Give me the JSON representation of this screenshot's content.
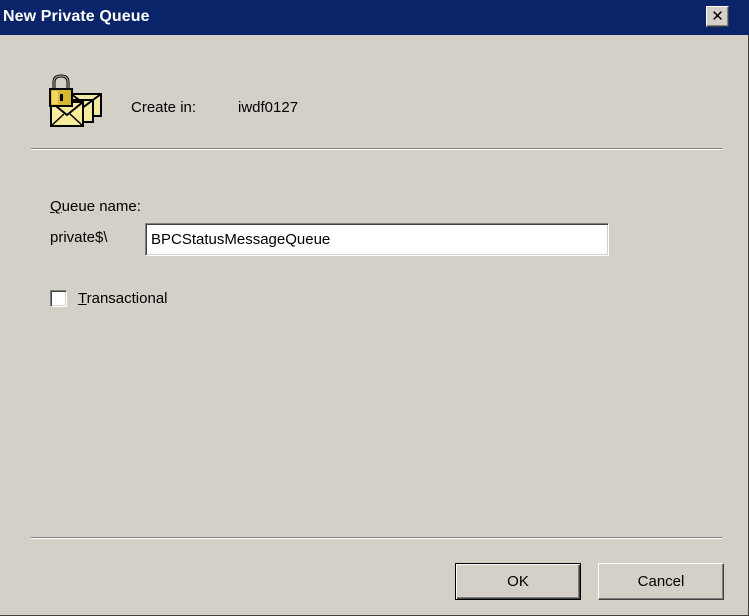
{
  "dialog": {
    "title": "New Private Queue",
    "close_glyph": "✕",
    "close_icon": "close-icon"
  },
  "location": {
    "icon": "queue-icon",
    "label": "Create in:",
    "value": "iwdf0127"
  },
  "queue_name": {
    "label_accel": "Q",
    "label_rest": "ueue name:",
    "prefix": "private$\\",
    "value": "BPCStatusMessageQueue"
  },
  "transactional": {
    "label_accel": "T",
    "label_rest": "ransactional",
    "checked": false
  },
  "buttons": {
    "ok": "OK",
    "cancel": "Cancel"
  },
  "colors": {
    "titlebar": "#0a246a",
    "face": "#d4d0c8",
    "icon_lock": "#d8b830",
    "icon_envelope": "#f4e9a0"
  }
}
